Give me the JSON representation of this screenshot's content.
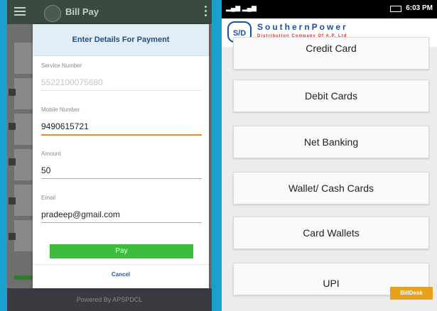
{
  "left": {
    "appbar": {
      "title": "Bill Pay"
    },
    "dialog": {
      "title": "Enter Details For Payment",
      "fields": [
        {
          "label": "Service Number",
          "value": "5522100075680"
        },
        {
          "label": "Mobile Number",
          "value": "9490615721"
        },
        {
          "label": "Amount",
          "value": "50"
        },
        {
          "label": "Email",
          "value": "pradeep@gmail.com"
        }
      ],
      "pay_label": "Pay",
      "cancel_label": "Cancel"
    },
    "footer": "Powered By APSPDCL"
  },
  "right": {
    "status": {
      "time": "6:03 PM"
    },
    "brand": {
      "logo_text": "S/D",
      "name": "SouthernPower",
      "subtitle": "Distribution Company Of A.P. Ltd"
    },
    "options": [
      "Credit Card",
      "Debit Cards",
      "Net Banking",
      "Wallet/ Cash Cards",
      "Card Wallets",
      "UPI"
    ],
    "billdesk_label": "BillDesk"
  },
  "colors": {
    "border_blue": "#1c9fcf",
    "pay_green": "#3dbb3d",
    "active_underline": "#f0882a",
    "brand_blue": "#1d4fa0",
    "brand_red": "#e03030"
  }
}
